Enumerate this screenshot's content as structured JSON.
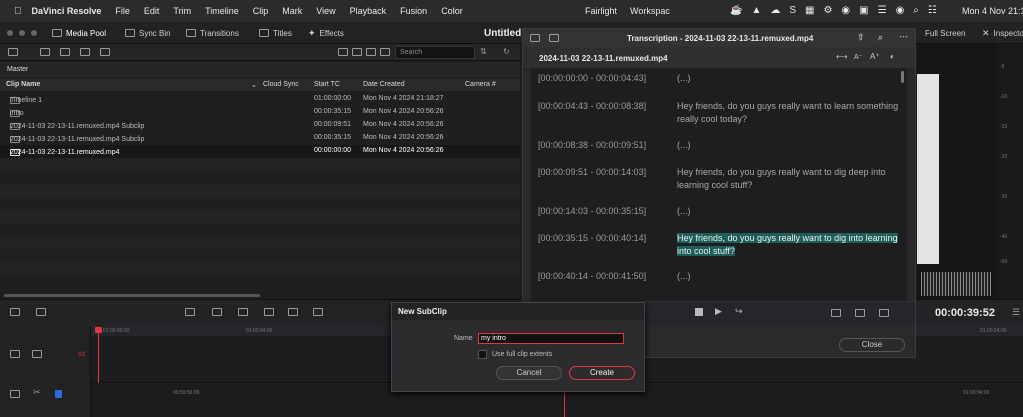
{
  "menubar": {
    "app": "DaVinci Resolve",
    "items": [
      "File",
      "Edit",
      "Trim",
      "Timeline",
      "Clip",
      "Mark",
      "View",
      "Playback",
      "Fusion",
      "Color"
    ],
    "workspace_items": [
      "Fairlight",
      "Workspac"
    ],
    "clock": "Mon 4 Nov 21:1"
  },
  "toolbar": {
    "media_pool": "Media Pool",
    "sync_bin": "Sync Bin",
    "transitions": "Transitions",
    "titles": "Titles",
    "effects": "Effects",
    "project_title": "Untitled",
    "full_screen": "Full Screen",
    "inspector": "Inspecto"
  },
  "media_pool": {
    "search_placeholder": "Search",
    "bin": "Master",
    "columns": {
      "name": "Clip Name",
      "cloud": "Cloud Sync",
      "start": "Start TC",
      "date": "Date Created",
      "camera": "Camera #"
    },
    "rows": [
      {
        "name": "Timeline 1",
        "start": "01:00:00:00",
        "date": "Mon Nov 4 2024 21:18:27"
      },
      {
        "name": "intro",
        "start": "00:00:35:15",
        "date": "Mon Nov 4 2024 20:56:26"
      },
      {
        "name": "2024-11-03 22-13-11.remuxed.mp4 Subclip",
        "start": "00:00:09:51",
        "date": "Mon Nov 4 2024 20:56:26"
      },
      {
        "name": "2024-11-03 22-13-11.remuxed.mp4 Subclip",
        "start": "00:00:35:15",
        "date": "Mon Nov 4 2024 20:56:26"
      },
      {
        "name": "2024-11-03 22-13-11.remuxed.mp4",
        "start": "00:00:00:00",
        "date": "Mon Nov 4 2024 20:56:26"
      }
    ]
  },
  "transcription": {
    "window_title": "Transcription - 2024-11-03 22-13-11.remuxed.mp4",
    "file_name": "2024-11-03 22-13-11.remuxed.mp4",
    "segments": [
      {
        "tc": "[00:00:00:00 - 00:00:04:43]",
        "text": "(...)"
      },
      {
        "tc": "[00:00:04:43 - 00:00:08:38]",
        "text": "Hey friends, do you guys really want to learn something really cool today?"
      },
      {
        "tc": "[00:00:08:38 - 00:00:09:51]",
        "text": "(...)"
      },
      {
        "tc": "[00:00:09:51 - 00:00:14:03]",
        "text": "Hey friends, do you guys really want to dig deep into learning cool stuff?"
      },
      {
        "tc": "[00:00:14:03 - 00:00:35:15]",
        "text": "(...)"
      },
      {
        "tc": "[00:00:35:15 - 00:00:40:14]",
        "text": "Hey friends, do you guys really want to dig into learning into cool stuff?"
      },
      {
        "tc": "[00:00:40:14 - 00:00:41:50]",
        "text": "(...)"
      }
    ],
    "close": "Close"
  },
  "viewer": {
    "timecode": "00:00:39:52",
    "meter_labels": [
      "-5",
      "-10",
      "-15",
      "-20",
      "-30",
      "-40",
      "-50"
    ]
  },
  "timeline": {
    "ruler_a": "01:00:00:00",
    "ruler_b": "01:00:04:00",
    "ruler_c": "01:00:24:00",
    "ruler_d": "00:59:56:00",
    "ruler_e": "01:00:04:00"
  },
  "dialog": {
    "title": "New SubClip",
    "name_label": "Name",
    "name_value": "my intro",
    "checkbox_label": "Use full clip extents",
    "cancel": "Cancel",
    "create": "Create"
  },
  "colors": {
    "accent": "#e0383f",
    "highlight": "#1d5e58",
    "ellipsis": "#e0913a",
    "playhead": "#e0383f"
  }
}
